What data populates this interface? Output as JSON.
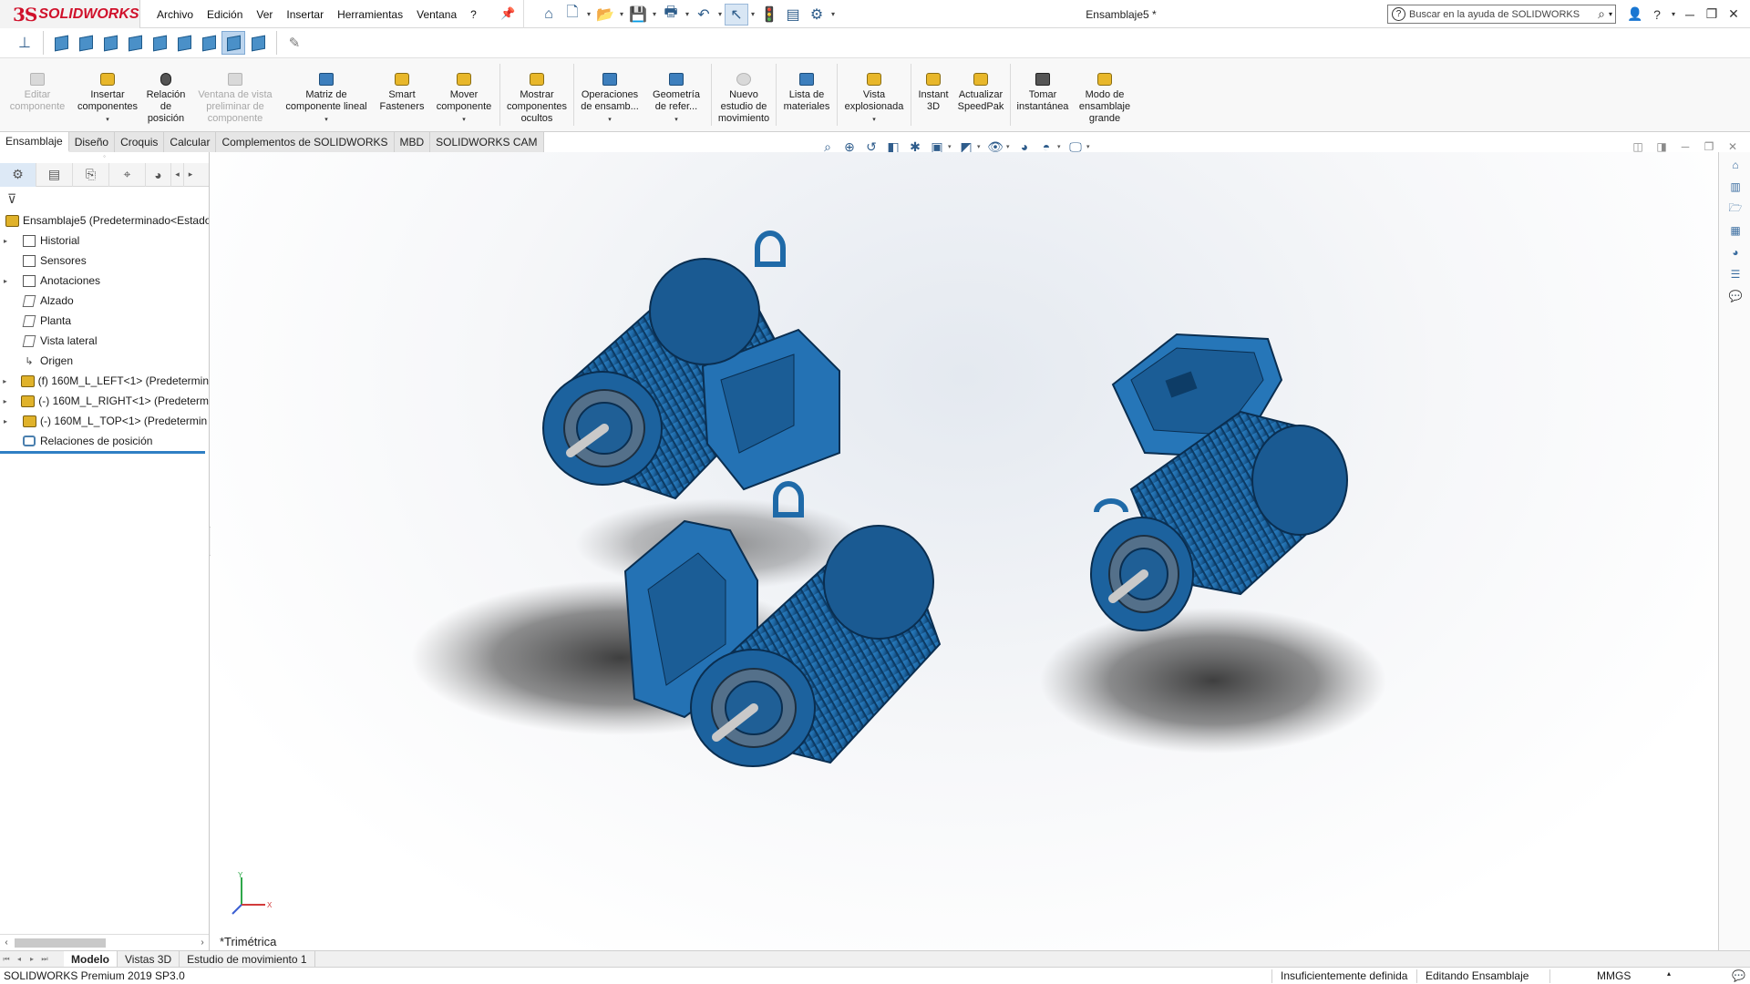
{
  "app": {
    "brand": "SOLIDWORKS",
    "window_title": "Ensamblaje5 *",
    "menu": [
      "Archivo",
      "Edición",
      "Ver",
      "Insertar",
      "Herramientas",
      "Ventana",
      "?"
    ],
    "search_placeholder": "Buscar en la ayuda de SOLIDWORKS",
    "accent_color": "#d0112b"
  },
  "command_manager": {
    "buttons": [
      {
        "label": "Editar\ncomponente",
        "icon": "edit-component-icon",
        "enabled": false
      },
      {
        "label": "Insertar\ncomponentes",
        "icon": "insert-components-icon",
        "enabled": true,
        "dropdown": true
      },
      {
        "label": "Relación\nde\nposición",
        "icon": "mate-icon",
        "enabled": true
      },
      {
        "label": "Ventana de vista\npreliminar de\ncomponente",
        "icon": "preview-window-icon",
        "enabled": false
      },
      {
        "label": "Matriz de\ncomponente lineal",
        "icon": "linear-pattern-icon",
        "enabled": true,
        "dropdown": true
      },
      {
        "label": "Smart\nFasteners",
        "icon": "smart-fasteners-icon",
        "enabled": true
      },
      {
        "label": "Mover\ncomponente",
        "icon": "move-component-icon",
        "enabled": true,
        "dropdown": true
      },
      {
        "label": "Mostrar\ncomponentes\nocultos",
        "icon": "show-hidden-icon",
        "enabled": true
      },
      {
        "label": "Operaciones\nde ensamb...",
        "icon": "assembly-features-icon",
        "enabled": true,
        "dropdown": true
      },
      {
        "label": "Geometría\nde refer...",
        "icon": "reference-geometry-icon",
        "enabled": true,
        "dropdown": true
      },
      {
        "label": "Nuevo\nestudio de\nmovimiento",
        "icon": "motion-study-icon",
        "enabled": true
      },
      {
        "label": "Lista de\nmateriales",
        "icon": "bom-icon",
        "enabled": true
      },
      {
        "label": "Vista\nexplosionada",
        "icon": "exploded-view-icon",
        "enabled": true,
        "dropdown": true
      },
      {
        "label": "Instant\n3D",
        "icon": "instant3d-icon",
        "enabled": true
      },
      {
        "label": "Actualizar\nSpeedPak",
        "icon": "speedpak-icon",
        "enabled": true
      },
      {
        "label": "Tomar\ninstantánea",
        "icon": "camera-icon",
        "enabled": true
      },
      {
        "label": "Modo de\nensamblaje\ngrande",
        "icon": "large-assembly-icon",
        "enabled": true
      }
    ]
  },
  "tabs": [
    "Ensamblaje",
    "Diseño",
    "Croquis",
    "Calcular",
    "Complementos de SOLIDWORKS",
    "MBD",
    "SOLIDWORKS CAM"
  ],
  "active_tab": "Ensamblaje",
  "feature_tree": {
    "root": "Ensamblaje5  (Predeterminado<Estado",
    "nodes": [
      {
        "label": "Historial",
        "expandable": true,
        "icon": "history-icon"
      },
      {
        "label": "Sensores",
        "expandable": false,
        "icon": "sensor-icon"
      },
      {
        "label": "Anotaciones",
        "expandable": true,
        "icon": "annotations-icon"
      },
      {
        "label": "Alzado",
        "expandable": false,
        "icon": "plane-icon"
      },
      {
        "label": "Planta",
        "expandable": false,
        "icon": "plane-icon"
      },
      {
        "label": "Vista lateral",
        "expandable": false,
        "icon": "plane-icon"
      },
      {
        "label": "Origen",
        "expandable": false,
        "icon": "origin-icon"
      },
      {
        "label": "(f) 160M_L_LEFT<1> (Predetermin",
        "expandable": true,
        "icon": "subassembly-icon"
      },
      {
        "label": "(-) 160M_L_RIGHT<1> (Predeterm",
        "expandable": true,
        "icon": "subassembly-icon"
      },
      {
        "label": "(-) 160M_L_TOP<1> (Predetermin",
        "expandable": true,
        "icon": "subassembly-icon"
      },
      {
        "label": "Relaciones de posición",
        "expandable": false,
        "icon": "mates-icon"
      }
    ]
  },
  "viewport": {
    "view_orientation": "*Trimétrica",
    "model_color": "#1f6aa8",
    "triad_labels": {
      "x": "X",
      "y": "Y"
    }
  },
  "bottom_tabs": [
    "Modelo",
    "Vistas 3D",
    "Estudio de movimiento 1"
  ],
  "active_bottom_tab": "Modelo",
  "status": {
    "product": "SOLIDWORKS Premium 2019 SP3.0",
    "definition": "Insuficientemente definida",
    "mode": "Editando Ensamblaje",
    "units": "MMGS"
  }
}
